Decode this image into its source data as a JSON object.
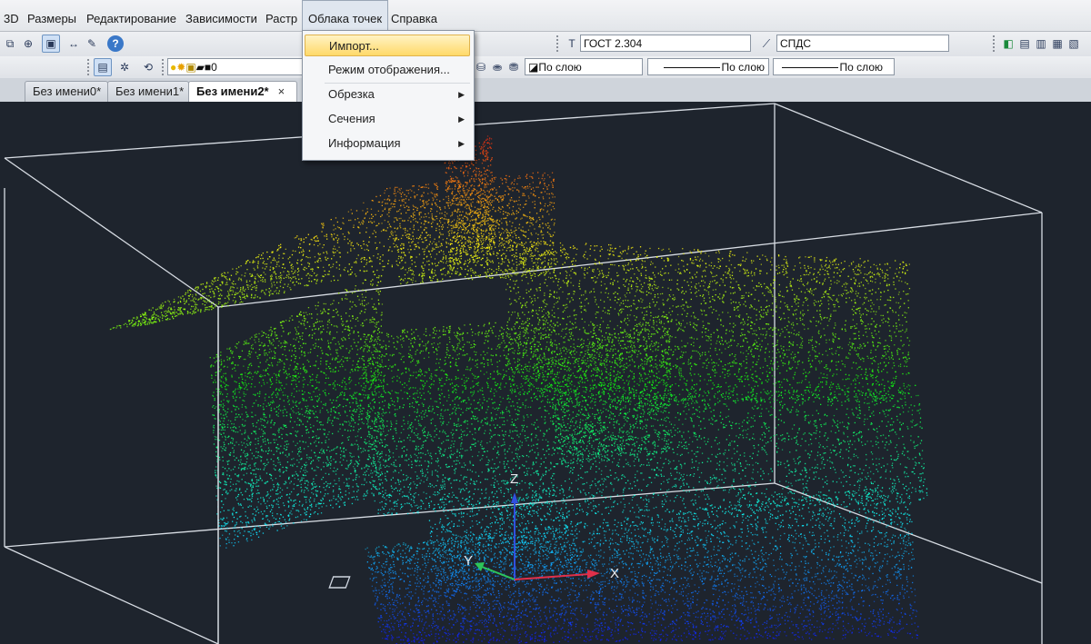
{
  "menubar": {
    "items": [
      "3D",
      "Размеры",
      "Редактирование",
      "Зависимости",
      "Растр",
      "Облака точек",
      "Справка"
    ]
  },
  "toolbar1": {
    "text_style": "ГОСТ 2.304",
    "dim_style": "СПДС"
  },
  "toolbar2": {
    "layer": "0",
    "color": "По слою",
    "linetype": "По слою",
    "lineweight": "По слою"
  },
  "tabs": [
    {
      "label": "Без имени0*"
    },
    {
      "label": "Без имени1*"
    },
    {
      "label": "Без имени2*",
      "close": "×"
    }
  ],
  "dropdown": {
    "items": [
      {
        "label": "Импорт...",
        "highlighted": true
      },
      {
        "label": "Режим отображения..."
      },
      {
        "label": "Обрезка",
        "submenu": true
      },
      {
        "label": "Сечения",
        "submenu": true
      },
      {
        "label": "Информация",
        "submenu": true
      }
    ]
  },
  "viewport": {
    "axes": {
      "x": "X",
      "y": "Y",
      "z": "Z"
    },
    "colors": {
      "background": "#1e242d",
      "box": "#d8dde4",
      "x_axis": "#e0304a",
      "y_axis": "#2ec45a",
      "z_axis": "#3050e0"
    }
  },
  "icons": [
    "zoom-window-icon",
    "zoom-icon",
    "view-icon",
    "distance-icon",
    "pencil-icon",
    "help-icon",
    "text-style-icon",
    "dim-style-icon",
    "layer-manager-icon",
    "bulb-icon",
    "sun-icon",
    "lock-icon",
    "printer-icon",
    "color-icon"
  ]
}
